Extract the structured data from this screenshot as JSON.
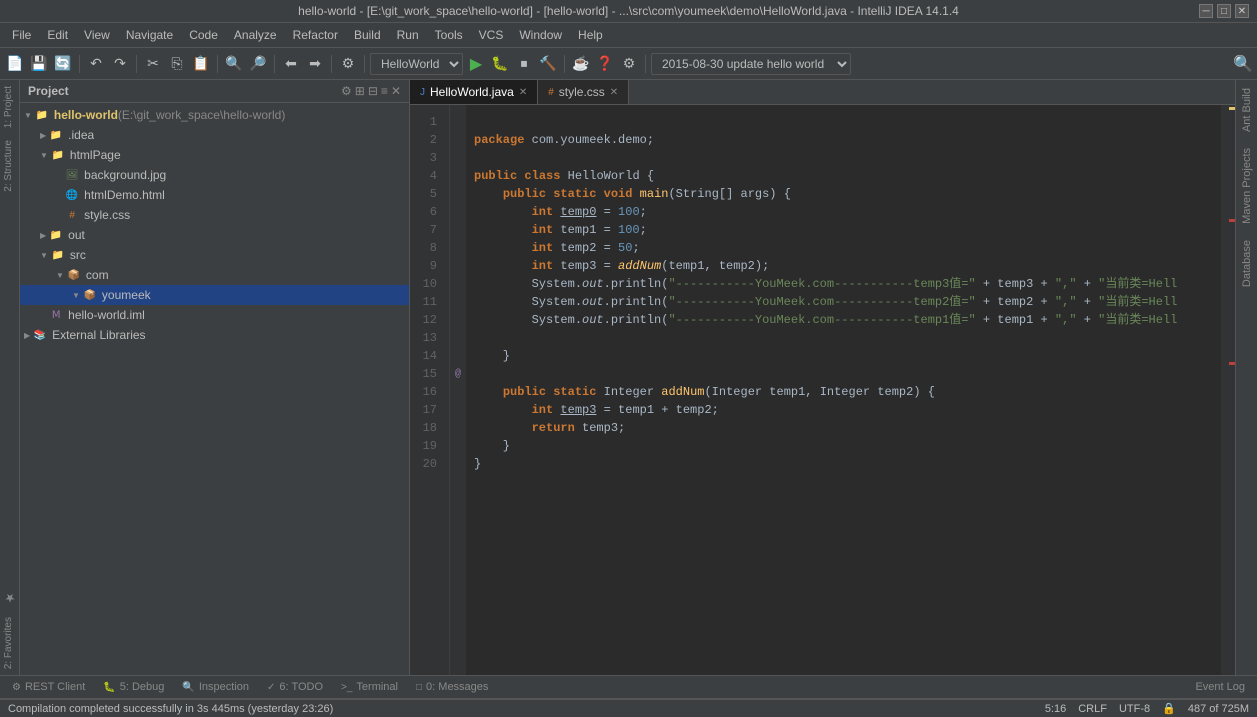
{
  "title": {
    "text": "hello-world - [E:\\git_work_space\\hello-world] - [hello-world] - ...\\src\\com\\youmeek\\demo\\HelloWorld.java - IntelliJ IDEA 14.1.4"
  },
  "menu": {
    "items": [
      "File",
      "Edit",
      "View",
      "Navigate",
      "Code",
      "Analyze",
      "Refactor",
      "Build",
      "Run",
      "Tools",
      "VCS",
      "Window",
      "Help"
    ]
  },
  "toolbar": {
    "dropdown_project": "HelloWorld ▾",
    "dropdown_vcs": "2015-08-30 update hello world ▾"
  },
  "project_panel": {
    "title": "Project",
    "root": "hello-world (E:\\git_work_space\\hello-world)",
    "items": [
      {
        "label": ".idea",
        "type": "folder",
        "indent": 1,
        "expanded": false
      },
      {
        "label": "htmlPage",
        "type": "folder",
        "indent": 1,
        "expanded": true
      },
      {
        "label": "background.jpg",
        "type": "image",
        "indent": 2
      },
      {
        "label": "htmlDemo.html",
        "type": "html",
        "indent": 2
      },
      {
        "label": "style.css",
        "type": "css",
        "indent": 2
      },
      {
        "label": "out",
        "type": "folder",
        "indent": 1,
        "expanded": false
      },
      {
        "label": "src",
        "type": "folder",
        "indent": 1,
        "expanded": true
      },
      {
        "label": "com",
        "type": "folder",
        "indent": 2,
        "expanded": true
      },
      {
        "label": "youmeek",
        "type": "folder",
        "indent": 3,
        "expanded": true,
        "selected": true
      },
      {
        "label": "hello-world.iml",
        "type": "iml",
        "indent": 1
      },
      {
        "label": "External Libraries",
        "type": "folder",
        "indent": 0,
        "expanded": false
      }
    ]
  },
  "tabs": [
    {
      "label": "HelloWorld.java",
      "type": "java",
      "active": true
    },
    {
      "label": "style.css",
      "type": "css",
      "active": false
    }
  ],
  "code": {
    "lines": [
      {
        "num": 1,
        "text": "package com.youmeek.demo;",
        "gutter": ""
      },
      {
        "num": 2,
        "text": "",
        "gutter": ""
      },
      {
        "num": 3,
        "text": "public class HelloWorld {",
        "gutter": ""
      },
      {
        "num": 4,
        "text": "    public static void main(String[] args) {",
        "gutter": ""
      },
      {
        "num": 5,
        "text": "        int temp0 = 100;",
        "gutter": ""
      },
      {
        "num": 6,
        "text": "        int temp1 = 100;",
        "gutter": ""
      },
      {
        "num": 7,
        "text": "        int temp2 = 50;",
        "gutter": ""
      },
      {
        "num": 8,
        "text": "        int temp3 = addNum(temp1, temp2);",
        "gutter": ""
      },
      {
        "num": 9,
        "text": "        System.out.println(\"-----------YouMeek.com-----------temp3值=\" + temp3 + \",\" + \"当前类=Hell",
        "gutter": ""
      },
      {
        "num": 10,
        "text": "        System.out.println(\"-----------YouMeek.com-----------temp2值=\" + temp2 + \",\" + \"当前类=Hell",
        "gutter": ""
      },
      {
        "num": 11,
        "text": "        System.out.println(\"-----------YouMeek.com-----------temp1值=\" + temp1 + \",\" + \"当前类=Hell",
        "gutter": ""
      },
      {
        "num": 12,
        "text": "",
        "gutter": ""
      },
      {
        "num": 13,
        "text": "    }",
        "gutter": ""
      },
      {
        "num": 14,
        "text": "",
        "gutter": ""
      },
      {
        "num": 15,
        "text": "    public static Integer addNum(Integer temp1, Integer temp2) {",
        "gutter": "@"
      },
      {
        "num": 16,
        "text": "        int temp3 = temp1 + temp2;",
        "gutter": ""
      },
      {
        "num": 17,
        "text": "        return temp3;",
        "gutter": ""
      },
      {
        "num": 18,
        "text": "    }",
        "gutter": ""
      },
      {
        "num": 19,
        "text": "}",
        "gutter": ""
      },
      {
        "num": 20,
        "text": "",
        "gutter": ""
      }
    ]
  },
  "tool_tabs": [
    {
      "icon": "⚙",
      "label": "REST Client",
      "num": ""
    },
    {
      "icon": "🐛",
      "label": "5: Debug",
      "num": "5"
    },
    {
      "icon": "🔍",
      "label": "Inspection",
      "num": ""
    },
    {
      "icon": "✓",
      "label": "6: TODO",
      "num": "6"
    },
    {
      "icon": ">_",
      "label": "Terminal",
      "num": ""
    },
    {
      "icon": "□",
      "label": "0: Messages",
      "num": "0"
    }
  ],
  "event_log": {
    "label": "Event Log"
  },
  "status_bar": {
    "message": "Compilation completed successfully in 3s 445ms (yesterday 23:26)",
    "position": "5:16",
    "line_sep": "CRLF",
    "encoding": "UTF-8",
    "lock": "🔒",
    "location": "487 of 725M"
  },
  "right_panels": {
    "tabs": [
      "Ant Build",
      "Maven Projects",
      "Database"
    ]
  },
  "left_panels": {
    "tabs": [
      "1: Project",
      "2: Structure",
      "2: Favorites"
    ]
  }
}
